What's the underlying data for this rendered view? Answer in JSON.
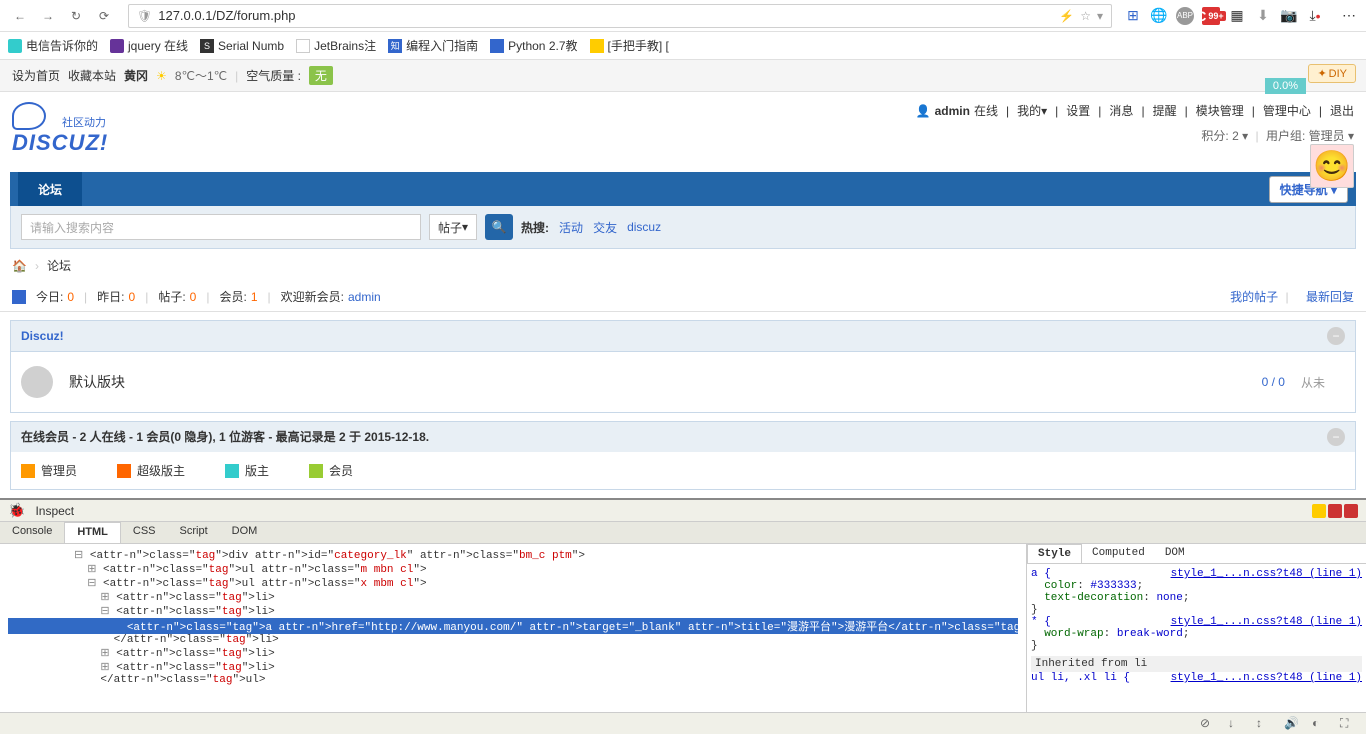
{
  "browser": {
    "url": "127.0.0.1/DZ/forum.php"
  },
  "bookmarks": [
    {
      "label": "电信告诉你的"
    },
    {
      "label": "jquery 在线"
    },
    {
      "label": "Serial Numb"
    },
    {
      "label": "JetBrains注"
    },
    {
      "label": "编程入门指南"
    },
    {
      "label": "Python 2.7教"
    },
    {
      "label": "[手把手教] ["
    }
  ],
  "topbar": {
    "set_home": "设为首页",
    "favorite": "收藏本站",
    "location": "黄冈",
    "weather": "8℃～1℃",
    "air_label": "空气质量 :",
    "air_value": "无",
    "diy": "DIY",
    "percent": "0.0%"
  },
  "logo": {
    "main": "DISCUZ!",
    "sub": "社区动力"
  },
  "user": {
    "name": "admin",
    "status": "在线",
    "my": "我的",
    "settings": "设置",
    "messages": "消息",
    "alerts": "提醒",
    "module_mgmt": "模块管理",
    "admin_center": "管理中心",
    "logout": "退出",
    "points_label": "积分:",
    "points_value": "2",
    "group_label": "用户组:",
    "group_value": "管理员"
  },
  "nav": {
    "forum": "论坛",
    "quick": "快捷导航"
  },
  "search": {
    "placeholder": "请输入搜索内容",
    "type": "帖子",
    "hot_label": "热搜:",
    "hot_items": [
      "活动",
      "交友",
      "discuz"
    ]
  },
  "breadcrumb": {
    "current": "论坛"
  },
  "stats": {
    "today_label": "今日:",
    "today": "0",
    "yesterday_label": "昨日:",
    "yesterday": "0",
    "posts_label": "帖子:",
    "posts": "0",
    "members_label": "会员:",
    "members": "1",
    "welcome_label": "欢迎新会员:",
    "welcome_user": "admin",
    "my_posts": "我的帖子",
    "latest_replies": "最新回复"
  },
  "section": {
    "title": "Discuz!",
    "forum_name": "默认版块",
    "count": "0 / 0",
    "last": "从未"
  },
  "online": {
    "header": "在线会员 - 2 人在线 - 1 会员(0 隐身), 1 位游客 - 最高记录是 2 于 2015-12-18.",
    "legend": [
      {
        "label": "管理员"
      },
      {
        "label": "超级版主"
      },
      {
        "label": "版主"
      },
      {
        "label": "会员"
      }
    ]
  },
  "devtools": {
    "inspect": "Inspect",
    "tabs": [
      "Console",
      "HTML",
      "CSS",
      "Script",
      "DOM"
    ],
    "active_tab": "HTML",
    "style_tabs": [
      "Style",
      "Computed",
      "DOM"
    ],
    "active_style_tab": "Style",
    "html_lines": [
      {
        "indent": 10,
        "toggle": "⊟",
        "text": "<div id=\"category_lk\" class=\"bm_c ptm\">"
      },
      {
        "indent": 12,
        "toggle": "⊞",
        "text": "<ul class=\"m mbn cl\">"
      },
      {
        "indent": 12,
        "toggle": "⊟",
        "text": "<ul class=\"x mbm cl\">"
      },
      {
        "indent": 14,
        "toggle": "⊞",
        "text": "<li>"
      },
      {
        "indent": 14,
        "toggle": "⊟",
        "text": "<li>"
      },
      {
        "indent": 16,
        "toggle": "",
        "highlighted": true,
        "text": "<a href=\"http://www.manyou.com/\" target=\"_blank\" title=\"漫游平台\">漫游平台</a>"
      },
      {
        "indent": 14,
        "toggle": "",
        "text": "</li>"
      },
      {
        "indent": 14,
        "toggle": "⊞",
        "text": "<li>"
      },
      {
        "indent": 14,
        "toggle": "⊞",
        "text": "<li>"
      },
      {
        "indent": 12,
        "toggle": "",
        "text": "</ul>"
      }
    ],
    "css_rules": [
      {
        "selector": "a {",
        "src": "style_1_...n.css?t48 (line 1)",
        "props": [
          {
            "p": "color",
            "v": "#333333"
          },
          {
            "p": "text-decoration",
            "v": "none"
          }
        ]
      },
      {
        "selector": "* {",
        "src": "style_1_...n.css?t48 (line 1)",
        "props": [
          {
            "p": "word-wrap",
            "v": "break-word"
          }
        ]
      }
    ],
    "inherited_label": "Inherited from li",
    "inherited_rule": {
      "selector": "ul li, .xl li {",
      "src": "style_1_...n.css?t48 (line 1)"
    }
  }
}
